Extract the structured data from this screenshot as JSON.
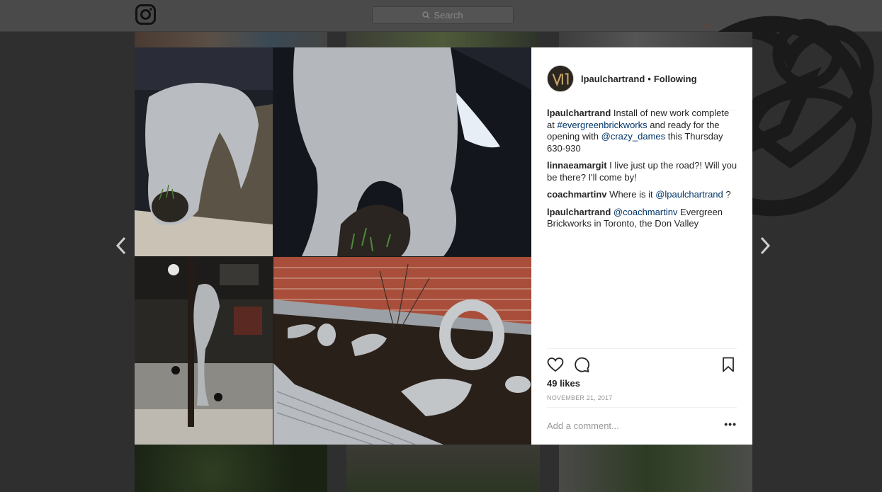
{
  "topbar": {
    "search_placeholder": "Search",
    "icons": [
      "instagram-logo-icon",
      "search-icon",
      "explore-compass-icon",
      "activity-heart-icon",
      "profile-icon"
    ]
  },
  "post": {
    "username": "lpaulchartrand",
    "separator": "•",
    "follow_status": "Following",
    "caption": {
      "username": "lpaulchartrand",
      "text_1": "Install of new work complete at ",
      "hashtag": "#evergreenbrickworks",
      "text_2": " and ready for the opening with ",
      "mention": "@crazy_dames",
      "text_3": " this Thursday 630-930"
    },
    "comments": [
      {
        "username": "linnaeamargit",
        "text": "I live just up the road?! Will you be there? I'll come by!"
      },
      {
        "username": "coachmartinv",
        "text_1": "Where is it ",
        "mention": "@lpaulchartrand",
        "text_2": " ?"
      },
      {
        "username": "lpaulchartrand",
        "mention": "@coachmartinv",
        "text_2": " Evergreen Brickworks in Toronto, the Don Valley"
      }
    ],
    "likes": "49 likes",
    "date": "NOVEMBER 21, 2017",
    "add_comment_placeholder": "Add a comment...",
    "more_label": "•••"
  },
  "colors": {
    "link": "#003569",
    "text": "#262626",
    "muted": "#999999",
    "overlay": "#2f2f2f"
  }
}
